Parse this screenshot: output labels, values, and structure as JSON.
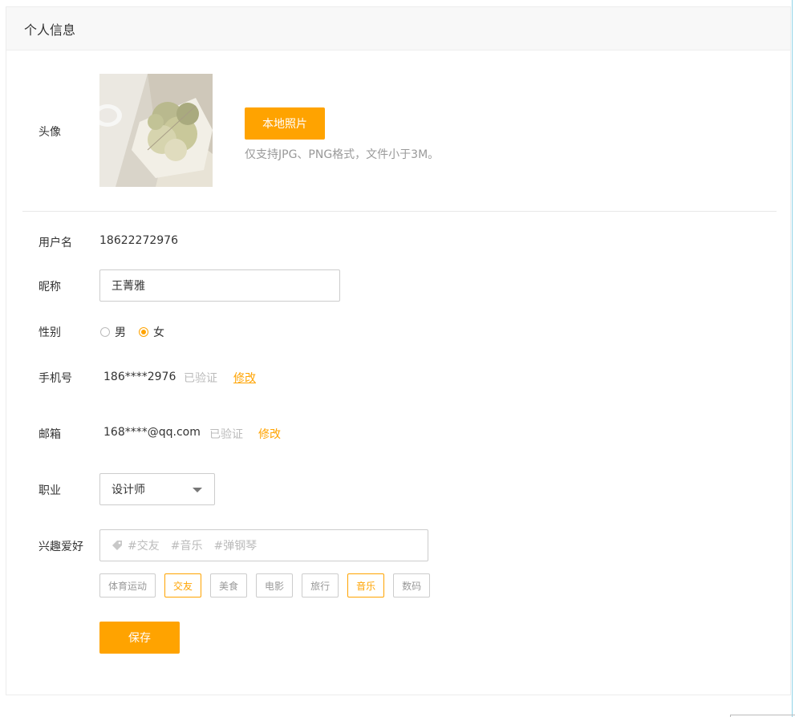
{
  "header": {
    "title": "个人信息"
  },
  "avatar": {
    "label": "头像",
    "upload_button": "本地照片",
    "hint": "仅支持JPG、PNG格式，文件小于3M。"
  },
  "username": {
    "label": "用户名",
    "value": "18622272976"
  },
  "nickname": {
    "label": "昵称",
    "value": "王菁雅"
  },
  "gender": {
    "label": "性别",
    "options": [
      {
        "label": "男",
        "checked": false
      },
      {
        "label": "女",
        "checked": true
      }
    ]
  },
  "phone": {
    "label": "手机号",
    "value": "186****2976",
    "status": "已验证",
    "action": "修改"
  },
  "email": {
    "label": "邮箱",
    "value": "168****@qq.com",
    "status": "已验证",
    "action": "修改"
  },
  "occupation": {
    "label": "职业",
    "value": "设计师"
  },
  "interests": {
    "label": "兴趣爱好",
    "input_tags": [
      "#交友",
      "#音乐",
      "#弹钢琴"
    ],
    "chips": [
      {
        "label": "体育运动",
        "active": false
      },
      {
        "label": "交友",
        "active": true
      },
      {
        "label": "美食",
        "active": false
      },
      {
        "label": "电影",
        "active": false
      },
      {
        "label": "旅行",
        "active": false
      },
      {
        "label": "音乐",
        "active": true
      },
      {
        "label": "数码",
        "active": false
      }
    ]
  },
  "save_button": "保存",
  "colors": {
    "accent": "#ffa300",
    "muted": "#bbbbbb",
    "border": "#cccccc"
  },
  "icons": {
    "tag": "tag-icon",
    "dropdown": "chevron-down-icon"
  }
}
